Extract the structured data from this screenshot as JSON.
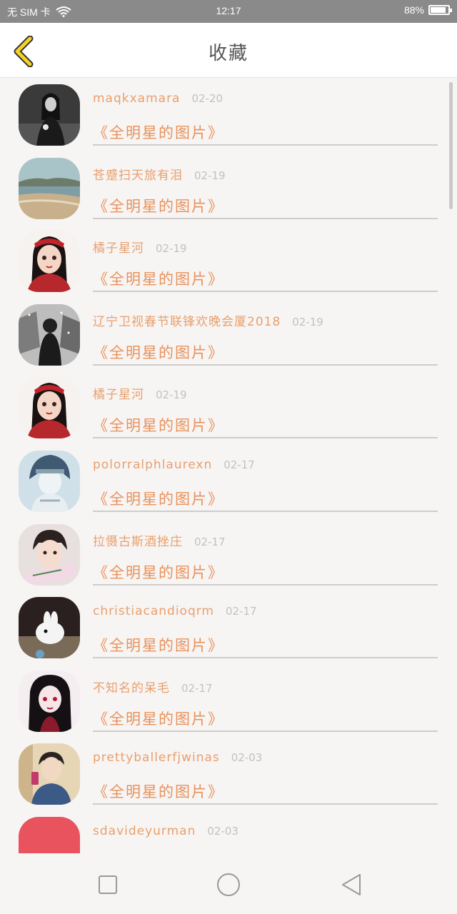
{
  "status_bar": {
    "carrier": "无 SIM 卡",
    "time": "12:17",
    "battery": "88%",
    "battery_level": 0.88
  },
  "header": {
    "title": "收藏",
    "back_icon": "chevron-left-icon",
    "accent": "#f5d228"
  },
  "list": {
    "items": [
      {
        "user": "maqkxamara",
        "date": "02-20",
        "album": "《全明星的图片》",
        "avatar": "bw-portrait"
      },
      {
        "user": "苍蹙扫天旅有泪",
        "date": "02-19",
        "album": "《全明星的图片》",
        "avatar": "beach"
      },
      {
        "user": "橘子星河",
        "date": "02-19",
        "album": "《全明星的图片》",
        "avatar": "girl-red"
      },
      {
        "user": "辽宁卫视春节联锋欢晚会厦2018",
        "date": "02-19",
        "album": "《全明星的图片》",
        "avatar": "man-snow"
      },
      {
        "user": "橘子星河",
        "date": "02-19",
        "album": "《全明星的图片》",
        "avatar": "girl-red"
      },
      {
        "user": "polorralphlaurexn",
        "date": "02-17",
        "album": "《全明星的图片》",
        "avatar": "anime-boy"
      },
      {
        "user": "拉慑古斯酒挫庄",
        "date": "02-17",
        "album": "《全明星的图片》",
        "avatar": "boy-sign"
      },
      {
        "user": "christiacandioqrm",
        "date": "02-17",
        "album": "《全明星的图片》",
        "avatar": "rabbit"
      },
      {
        "user": "不知名的呆毛",
        "date": "02-17",
        "album": "《全明星的图片》",
        "avatar": "anime-girl"
      },
      {
        "user": "prettyballerfjwinas",
        "date": "02-03",
        "album": "《全明星的图片》",
        "avatar": "selfie"
      },
      {
        "user": "sdavideyurman",
        "date": "02-03",
        "album": "",
        "avatar": "mustache"
      }
    ]
  },
  "nav": {
    "recent_icon": "square-icon",
    "home_icon": "circle-icon",
    "back_icon": "triangle-back-icon"
  }
}
